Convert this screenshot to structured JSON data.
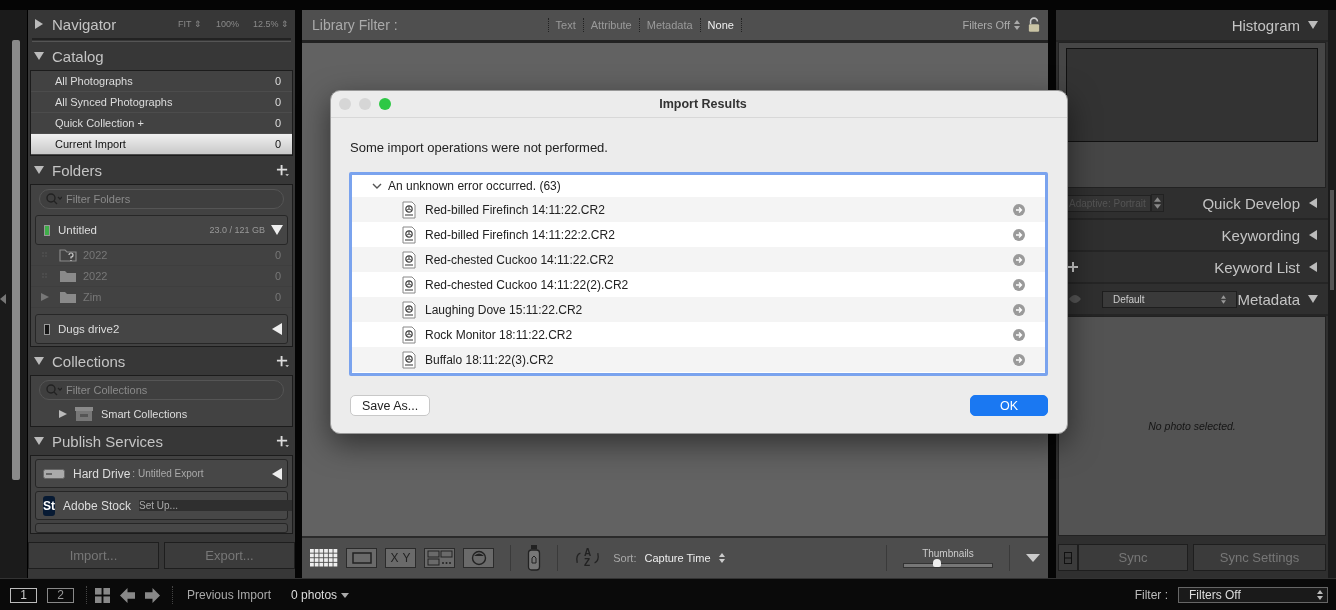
{
  "navigator": {
    "title": "Navigator",
    "expanded": false,
    "zoom_options": [
      "FIT ⇕",
      "100%",
      "12.5% ⇕"
    ]
  },
  "catalog": {
    "title": "Catalog",
    "expanded": true,
    "items": [
      {
        "name": "All Photographs",
        "count": "0",
        "selected": false
      },
      {
        "name": "All Synced Photographs",
        "count": "0",
        "selected": false
      },
      {
        "name": "Quick Collection +",
        "count": "0",
        "selected": false
      },
      {
        "name": "Current Import",
        "count": "0",
        "selected": true
      }
    ]
  },
  "folders": {
    "title": "Folders",
    "expanded": true,
    "filter_placeholder": "Filter Folders",
    "volumes": [
      {
        "name": "Untitled",
        "usage": "23.0 / 121 GB",
        "color": "#3fae49",
        "expanded": true,
        "folders": [
          {
            "name": "2022",
            "count": "0",
            "kind": "missing",
            "has_children": false
          },
          {
            "name": "2022",
            "count": "0",
            "kind": "folder",
            "has_children": false
          },
          {
            "name": "Zim",
            "count": "0",
            "kind": "folder",
            "has_children": true
          }
        ]
      },
      {
        "name": "Dugs drive2",
        "color": "#161616",
        "expanded": false
      }
    ]
  },
  "collections": {
    "title": "Collections",
    "expanded": true,
    "filter_placeholder": "Filter Collections",
    "items": [
      {
        "name": "Smart Collections"
      }
    ]
  },
  "publish_services": {
    "title": "Publish Services",
    "expanded": true,
    "services": [
      {
        "name": "Hard Drive",
        "detail": ": Untitled Export",
        "kind": "drive"
      },
      {
        "name": "Adobe Stock",
        "detail": "Set Up...",
        "kind": "stock",
        "logo": "St"
      }
    ]
  },
  "left_buttons": [
    "Import...",
    "Export..."
  ],
  "library_filter": {
    "label": "Library Filter :",
    "tabs": [
      {
        "label": "Text",
        "selected": false
      },
      {
        "label": "Attribute",
        "selected": false
      },
      {
        "label": "Metadata",
        "selected": false
      },
      {
        "label": "None",
        "selected": true
      }
    ],
    "preset": "Filters Off"
  },
  "toolbar": {
    "compare_letters": "XY",
    "sort_letters": [
      "A",
      "Z"
    ],
    "sort_label": "Sort:",
    "sort": "Capture Time",
    "thumbnails_label": "Thumbnails",
    "thumbnails": {
      "level": 0.37
    }
  },
  "right_panels": [
    {
      "title": "Histogram",
      "expanded": true,
      "kind": "histogram"
    },
    {
      "title": "Quick Develop",
      "expanded": false,
      "kind": "preset",
      "preset": "Adaptive: Portrait"
    },
    {
      "title": "Keywording",
      "expanded": false,
      "kind": "plain"
    },
    {
      "title": "Keyword List",
      "expanded": false,
      "kind": "add"
    },
    {
      "title": "Metadata",
      "expanded": true,
      "kind": "metadata",
      "preset": "Default",
      "message": "No photo selected."
    }
  ],
  "sync_buttons": [
    "Sync",
    "Sync Settings"
  ],
  "auto_sync_on": false,
  "filmstrip": {
    "screens": [
      "1",
      "2"
    ],
    "source": "Previous Import",
    "count": "0 photos",
    "filter_label": "Filter :",
    "filter": "Filters Off"
  },
  "dialog": {
    "title": "Import Results",
    "message": "Some import operations were not performed.",
    "groups": [
      {
        "label": "An unknown error occurred. (63)",
        "expanded": true,
        "files": [
          "Red-billed Firefinch 14:11:22.CR2",
          "Red-billed Firefinch 14:11:22:2.CR2",
          "Red-chested Cuckoo 14:11:22.CR2",
          "Red-chested Cuckoo 14:11:22(2).CR2",
          "Laughing Dove 15:11:22.CR2",
          "Rock Monitor 18:11:22.CR2",
          "Buffalo 18:11:22(3).CR2"
        ]
      }
    ],
    "buttons": [
      {
        "label": "Save As...",
        "kind": "secondary"
      },
      {
        "label": "OK",
        "kind": "default"
      }
    ]
  }
}
